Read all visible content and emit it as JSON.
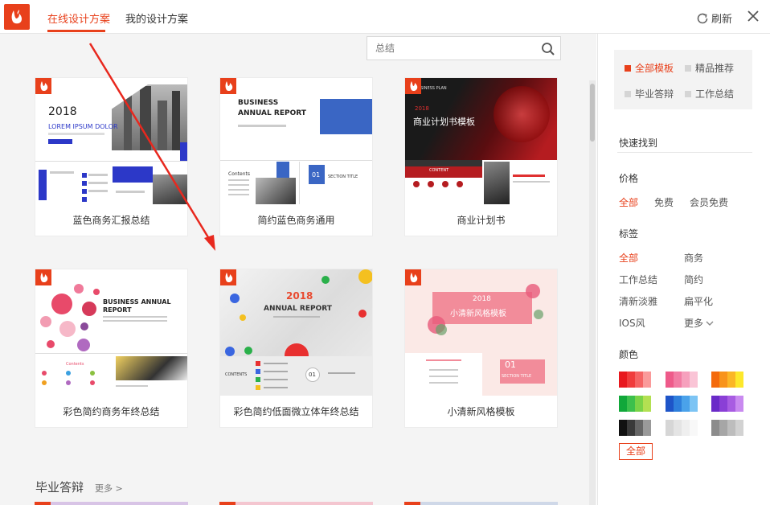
{
  "header": {
    "tabs": [
      {
        "label": "在线设计方案",
        "active": true
      },
      {
        "label": "我的设计方案",
        "active": false
      }
    ],
    "refresh_label": "刷新"
  },
  "search": {
    "placeholder": "总结"
  },
  "templates": [
    {
      "title": "蓝色商务汇报总结",
      "thumb_text": [
        "2018",
        "LOREM IPSUM DOLOR"
      ]
    },
    {
      "title": "简约蓝色商务通用",
      "thumb_text": [
        "BUSINESS",
        "ANNUAL REPORT",
        "Contents",
        "01",
        "SECTION TITLE"
      ]
    },
    {
      "title": "商业计划书",
      "thumb_text": [
        "BUSINESS PLAN",
        "2018",
        "商业计划书模板",
        "CONTENT"
      ]
    },
    {
      "title": "彩色简约商务年终总结",
      "thumb_text": [
        "BUSINESS ANNUAL",
        "REPORT",
        "Contents"
      ]
    },
    {
      "title": "彩色简约低面微立体年终总结",
      "thumb_text": [
        "2018",
        "ANNUAL REPORT",
        "CONTENTS",
        "01"
      ]
    },
    {
      "title": "小清新风格模板",
      "thumb_text": [
        "2018",
        "小清新风格模板",
        "01",
        "SECTION TITLE"
      ]
    }
  ],
  "section": {
    "title": "毕业答辩",
    "more": "更多 >"
  },
  "sidebar": {
    "categories": [
      {
        "label": "全部模板",
        "active": true
      },
      {
        "label": "精品推荐",
        "active": false
      },
      {
        "label": "毕业答辩",
        "active": false
      },
      {
        "label": "工作总结",
        "active": false
      }
    ],
    "quick_find": "快速找到",
    "price_title": "价格",
    "price_options": [
      {
        "label": "全部",
        "active": true
      },
      {
        "label": "免费",
        "active": false
      },
      {
        "label": "会员免费",
        "active": false
      }
    ],
    "tags_title": "标签",
    "tags": [
      {
        "label": "全部",
        "active": true
      },
      {
        "label": "商务",
        "active": false
      },
      {
        "label": "工作总结",
        "active": false
      },
      {
        "label": "简约",
        "active": false
      },
      {
        "label": "清新淡雅",
        "active": false
      },
      {
        "label": "扁平化",
        "active": false
      },
      {
        "label": "IOS风",
        "active": false
      },
      {
        "label": "更多",
        "active": false
      }
    ],
    "color_title": "颜色",
    "color_all": "全部",
    "swatches": [
      [
        "#e8181e",
        "#f03c3c",
        "#f56464",
        "#fa9a9a"
      ],
      [
        "#ee5a8a",
        "#f27ca4",
        "#f6a0bd",
        "#fac4d6"
      ],
      [
        "#f46a0c",
        "#f8931a",
        "#fbb626",
        "#fde82c"
      ],
      [
        "#11a83a",
        "#3cc04c",
        "#7ad347",
        "#b3e052"
      ],
      [
        "#1e55c8",
        "#2e7fdc",
        "#4aa2ea",
        "#7cc4f4"
      ],
      [
        "#6a2bc8",
        "#8a3fd6",
        "#a85ce2",
        "#c98af0"
      ],
      [
        "#111111",
        "#3a3a3a",
        "#666666",
        "#999999"
      ],
      [
        "#d6d6d6",
        "#e4e4e4",
        "#efefef",
        "#f8f8f8"
      ],
      [
        "#8c8c8c",
        "#a6a6a6",
        "#bdbdbd",
        "#d2d2d2"
      ]
    ]
  },
  "colors": {
    "accent": "#e8401b"
  }
}
